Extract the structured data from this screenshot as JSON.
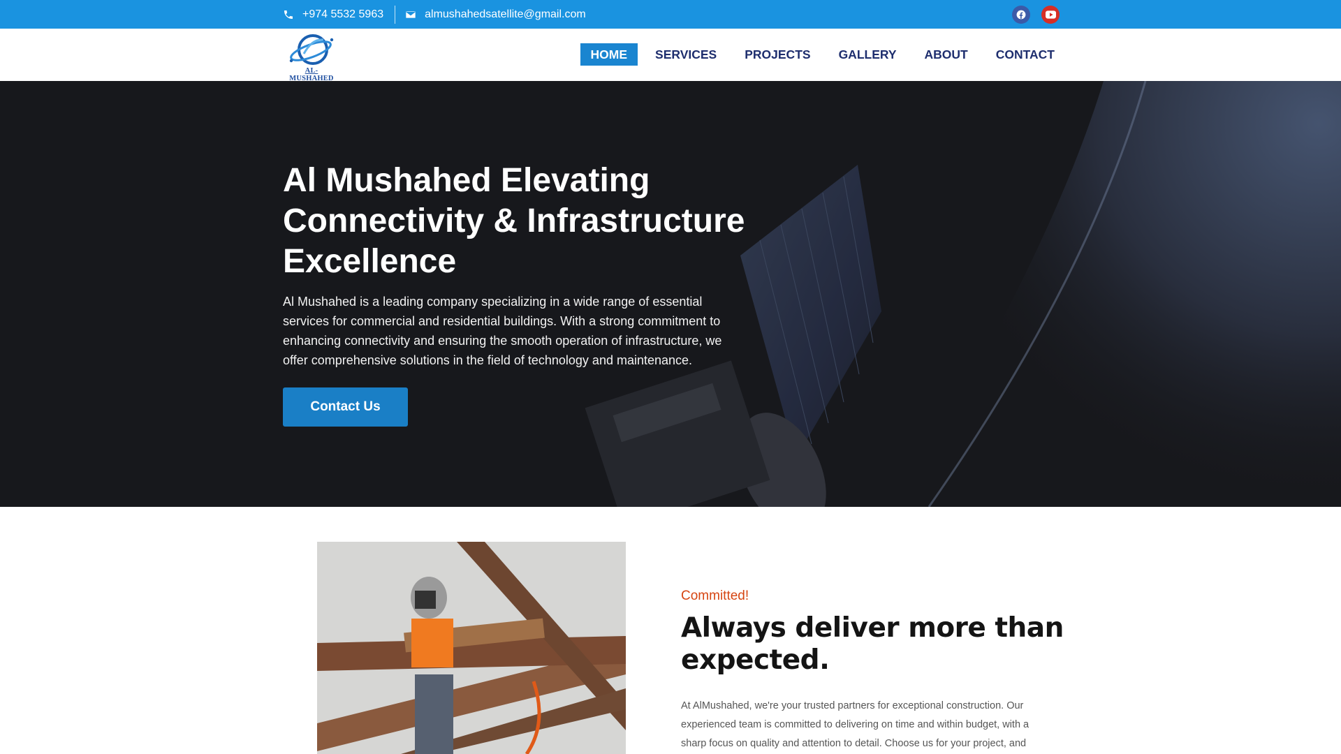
{
  "topbar": {
    "phone": "+974 5532 5963",
    "email": "almushahedsatellite@gmail.com",
    "social": [
      {
        "name": "facebook-icon",
        "color": "#3b5aa8"
      },
      {
        "name": "youtube-icon",
        "color": "#d62e26"
      }
    ],
    "background": "#1a93e0"
  },
  "header": {
    "logo_text": "AL-MUSHAHED",
    "nav": [
      {
        "label": "HOME",
        "active": true
      },
      {
        "label": "SERVICES",
        "active": false
      },
      {
        "label": "PROJECTS",
        "active": false
      },
      {
        "label": "GALLERY",
        "active": false
      },
      {
        "label": "ABOUT",
        "active": false
      },
      {
        "label": "CONTACT",
        "active": false
      }
    ],
    "nav_color": "#1e2e6e",
    "active_color": "#1a85d0"
  },
  "hero": {
    "title_lines": [
      "Al Mushahed Elevating",
      "Connectivity & Infrastructure",
      "Excellence"
    ],
    "description": "Al Mushahed is a leading company specializing in a wide range of essential services for commercial and residential buildings. With a strong commitment to enhancing connectivity and ensuring the smooth operation of infrastructure, we offer comprehensive solutions in the field of technology and maintenance.",
    "cta_label": "Contact Us",
    "cta_color": "#1a7fc6"
  },
  "commit": {
    "eyebrow": "Committed!",
    "title": "Always deliver more than expected.",
    "text": "At AlMushahed, we're your trusted partners for exceptional construction. Our experienced team is committed to delivering on time and within budget, with a sharp focus on quality and attention to detail. Choose us for your project, and",
    "eyebrow_color": "#d64512"
  }
}
